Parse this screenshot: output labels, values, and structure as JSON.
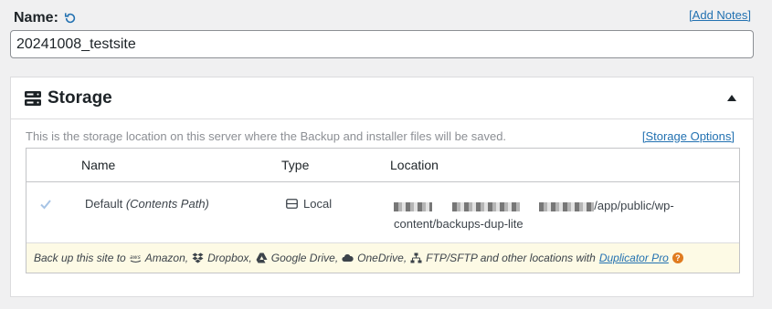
{
  "name_field": {
    "label": "Name:",
    "value": "20241008_testsite",
    "add_notes": "[Add Notes]"
  },
  "storage": {
    "title": "Storage",
    "description": "This is the storage location on this server where the Backup and installer files will be saved.",
    "options_link": "[Storage Options]",
    "columns": [
      "Name",
      "Type",
      "Location"
    ],
    "row": {
      "checked": true,
      "name": "Default",
      "name_suffix": "(Contents Path)",
      "type": "Local",
      "location_part1": "/app/public/wp-",
      "location_part2": "content/backups-dup-lite"
    },
    "promo": {
      "lead": "Back up this site to",
      "amazon": "Amazon,",
      "dropbox": "Dropbox,",
      "gdrive": "Google Drive,",
      "onedrive": "OneDrive,",
      "ftp": "FTP/SFTP and other locations with",
      "pro_link": "Duplicator Pro",
      "help": "?"
    }
  },
  "colors": {
    "link": "#2271b1",
    "promo_bg": "#fdfae5",
    "help_badge": "#e07b1f"
  }
}
